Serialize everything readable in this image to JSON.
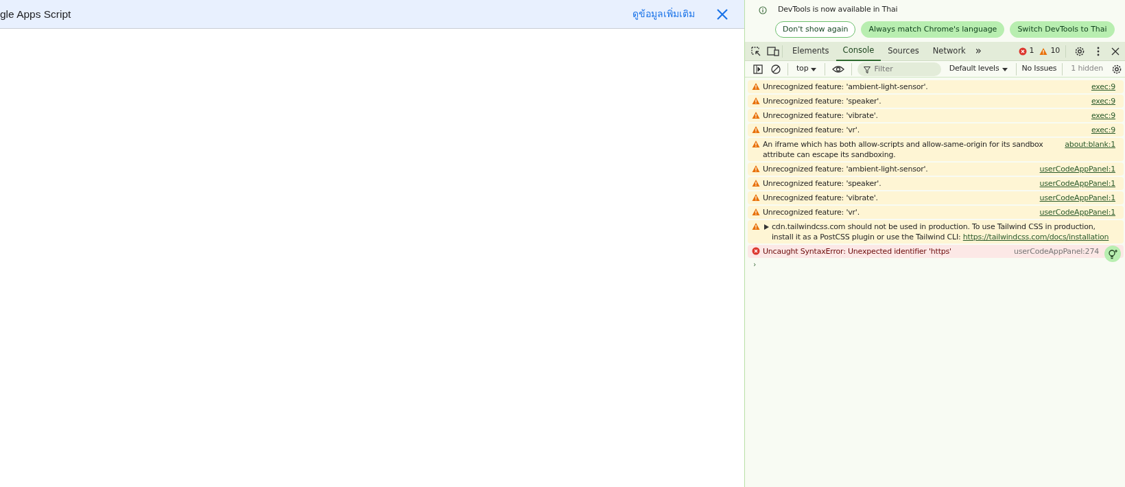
{
  "banner": {
    "title": "gle Apps Script",
    "link": "ดูข้อมูลเพิ่มเติม"
  },
  "devtools": {
    "infobar": {
      "message": "DevTools is now available in Thai",
      "buttons": [
        {
          "label": "Don't show again",
          "kind": "outline"
        },
        {
          "label": "Always match Chrome's language",
          "kind": "filled"
        },
        {
          "label": "Switch DevTools to Thai",
          "kind": "filled"
        }
      ]
    },
    "tabs": [
      {
        "label": "Elements",
        "selected": false
      },
      {
        "label": "Console",
        "selected": true
      },
      {
        "label": "Sources",
        "selected": false
      },
      {
        "label": "Network",
        "selected": false
      }
    ],
    "more_tabs": "»",
    "error_count": "1",
    "warning_count": "10",
    "console_toolbar": {
      "context": "top",
      "filter": {
        "placeholder": "Filter"
      },
      "levels": "Default levels",
      "issues": "No Issues",
      "hidden": "1 hidden"
    },
    "messages": [
      {
        "kind": "warning",
        "text": "Unrecognized feature: 'ambient-light-sensor'.",
        "source": "exec:9"
      },
      {
        "kind": "warning",
        "text": "Unrecognized feature: 'speaker'.",
        "source": "exec:9"
      },
      {
        "kind": "warning",
        "text": "Unrecognized feature: 'vibrate'.",
        "source": "exec:9"
      },
      {
        "kind": "warning",
        "text": "Unrecognized feature: 'vr'.",
        "source": "exec:9"
      },
      {
        "kind": "warning",
        "text": "An iframe which has both allow-scripts and allow-same-origin for its sandbox attribute can escape its sandboxing.",
        "source": "about:blank:1"
      },
      {
        "kind": "warning",
        "text": "Unrecognized feature: 'ambient-light-sensor'.",
        "source": "userCodeAppPanel:1"
      },
      {
        "kind": "warning",
        "text": "Unrecognized feature: 'speaker'.",
        "source": "userCodeAppPanel:1"
      },
      {
        "kind": "warning",
        "text": "Unrecognized feature: 'vibrate'.",
        "source": "userCodeAppPanel:1"
      },
      {
        "kind": "warning",
        "text": "Unrecognized feature: 'vr'.",
        "source": "userCodeAppPanel:1"
      },
      {
        "kind": "warning",
        "expandable": true,
        "text": "cdn.tailwindcss.com should not be used in production. To use Tailwind CSS in production, install it as a PostCSS plugin or use the Tailwind CLI: ",
        "link": "https://tailwindcss.com/docs/installation"
      },
      {
        "kind": "error",
        "text": "Uncaught SyntaxError: Unexpected identifier 'https'",
        "source": "userCodeAppPanel:274"
      }
    ],
    "prompt": "›"
  }
}
